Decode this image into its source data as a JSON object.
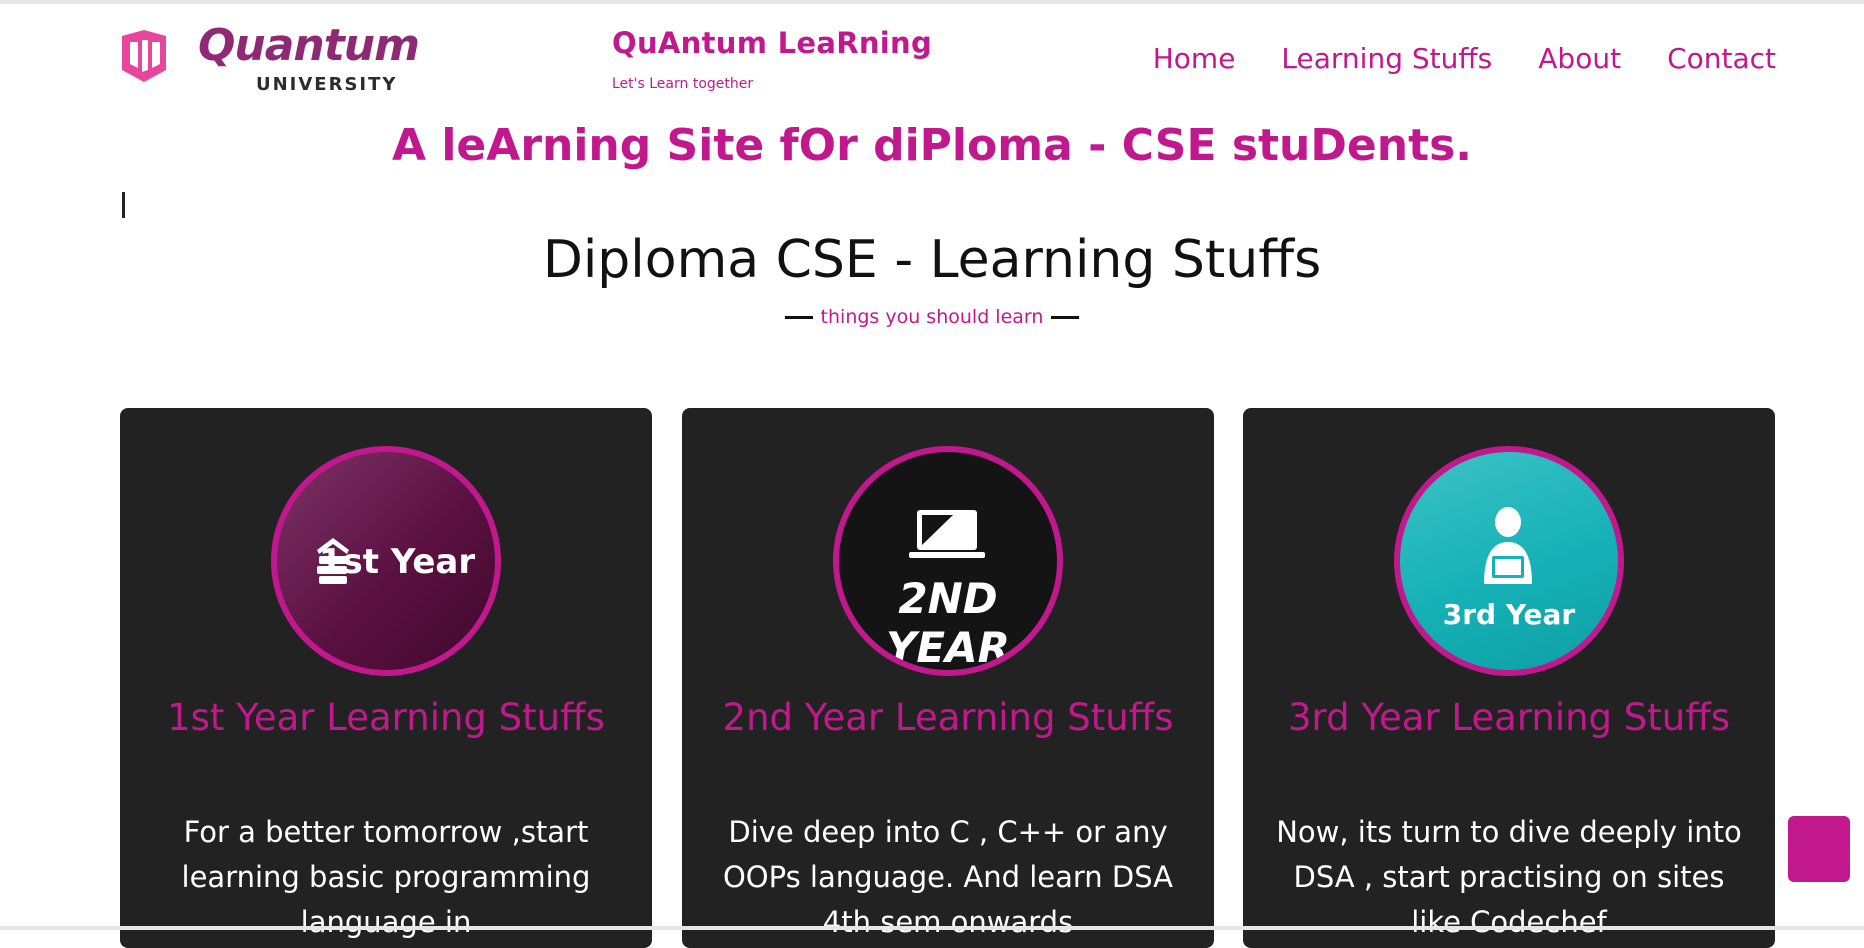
{
  "header": {
    "logo_word": "Quantum",
    "logo_sub": "UNIVERSITY",
    "site_name": "QuAntum LeaRning",
    "tagline": "Let's Learn together",
    "nav": [
      "Home",
      "Learning Stuffs",
      "About",
      "Contact"
    ]
  },
  "hero": {
    "text": "A leArning Site fOr diPloma - CSE stuDents."
  },
  "section": {
    "title": "Diploma CSE - Learning Stuffs",
    "subtitle": "things you should learn"
  },
  "cards": [
    {
      "badge": "1st Year",
      "title": "1st Year Learning Stuffs",
      "text": "For a better tomorrow ,start learning basic programming language in"
    },
    {
      "badge": "2ND YEAR",
      "title": "2nd Year Learning Stuffs",
      "text": "Dive deep into C , C++ or any OOPs language. And learn DSA 4th sem onwards"
    },
    {
      "badge": "3rd Year",
      "title": "3rd Year Learning Stuffs",
      "text": "Now, its turn to dive deeply into DSA , start practising on sites like Codechef"
    }
  ],
  "colors": {
    "accent": "#c2188e",
    "card_bg": "#222222",
    "logo_purple": "#8e2a74",
    "teal": "#15b1b6"
  },
  "icons": [
    "quantum-logo-mark-icon",
    "books-icon",
    "laptop-icon",
    "person-laptop-icon"
  ]
}
